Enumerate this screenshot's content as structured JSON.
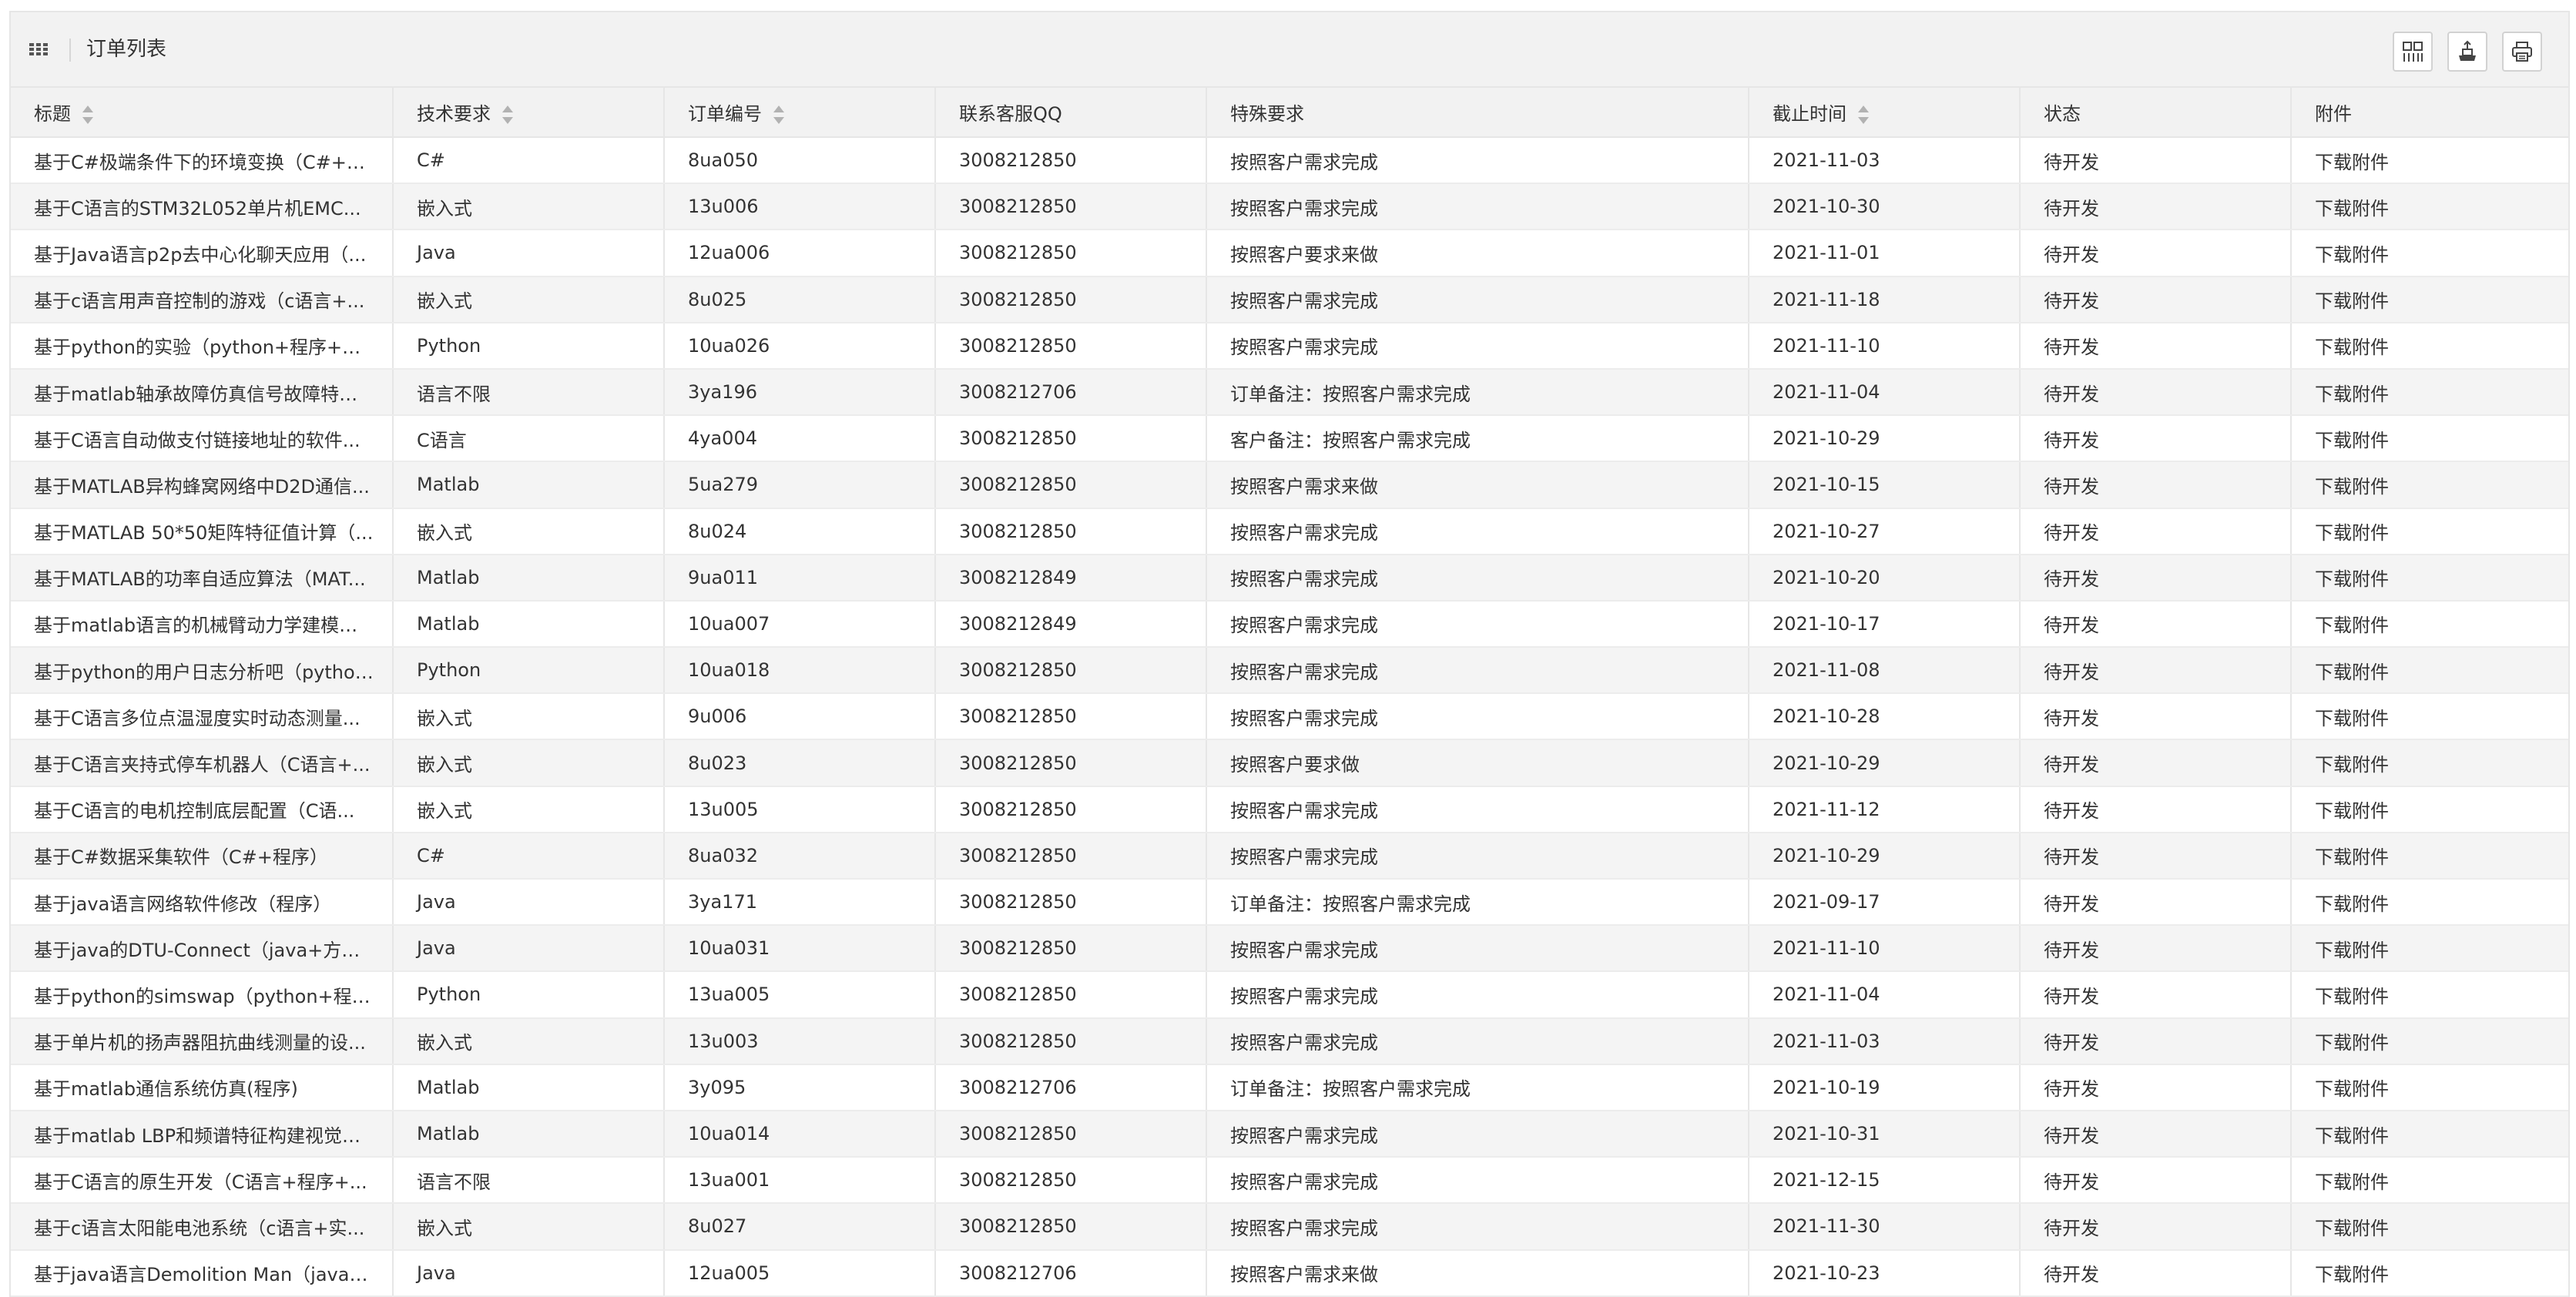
{
  "panel": {
    "title": "订单列表",
    "icons": {
      "menu": "grid-menu-icon",
      "columns": "columns-filter-icon",
      "export": "export-icon",
      "print": "print-icon"
    }
  },
  "table": {
    "columns": [
      "标题",
      "技术要求",
      "订单编号",
      "联系客服QQ",
      "特殊要求",
      "截止时间",
      "状态",
      "附件"
    ],
    "sortable_columns": [
      "标题",
      "技术要求",
      "订单编号",
      "截止时间"
    ],
    "rows": [
      [
        "基于C#极端条件下的环境变换（C#+程...",
        "C#",
        "8ua050",
        "3008212850",
        "按照客户需求完成",
        "2021-11-03",
        "待开发",
        "下载附件"
      ],
      [
        "基于C语言的STM32L052单片机EMC...",
        "嵌入式",
        "13u006",
        "3008212850",
        "按照客户需求完成",
        "2021-10-30",
        "待开发",
        "下载附件"
      ],
      [
        "基于Java语言p2p去中心化聊天应用（...",
        "Java",
        "12ua006",
        "3008212850",
        "按照客户要求来做",
        "2021-11-01",
        "待开发",
        "下载附件"
      ],
      [
        "基于c语言用声音控制的游戏（c语言+...",
        "嵌入式",
        "8u025",
        "3008212850",
        "按照客户需求完成",
        "2021-11-18",
        "待开发",
        "下载附件"
      ],
      [
        "基于python的实验（python+程序+方...",
        "Python",
        "10ua026",
        "3008212850",
        "按照客户需求完成",
        "2021-11-10",
        "待开发",
        "下载附件"
      ],
      [
        "基于matlab轴承故障仿真信号故障特征...",
        "语言不限",
        "3ya196",
        "3008212706",
        "订单备注：按照客户需求完成",
        "2021-11-04",
        "待开发",
        "下载附件"
      ],
      [
        "基于C语言自动做支付链接地址的软件...",
        "C语言",
        "4ya004",
        "3008212850",
        "客户备注：按照客户需求完成",
        "2021-10-29",
        "待开发",
        "下载附件"
      ],
      [
        "基于MATLAB异构蜂窝网络中D2D通信...",
        "Matlab",
        "5ua279",
        "3008212850",
        "按照客户需求来做",
        "2021-10-15",
        "待开发",
        "下载附件"
      ],
      [
        "基于MATLAB 50*50矩阵特征值计算（...",
        "嵌入式",
        "8u024",
        "3008212850",
        "按照客户需求完成",
        "2021-10-27",
        "待开发",
        "下载附件"
      ],
      [
        "基于MATLAB的功率自适应算法（MAT...",
        "Matlab",
        "9ua011",
        "3008212849",
        "按照客户需求完成",
        "2021-10-20",
        "待开发",
        "下载附件"
      ],
      [
        "基于matlab语言的机械臂动力学建模（...",
        "Matlab",
        "10ua007",
        "3008212849",
        "按照客户需求完成",
        "2021-10-17",
        "待开发",
        "下载附件"
      ],
      [
        "基于python的用户日志分析吧（python...",
        "Python",
        "10ua018",
        "3008212850",
        "按照客户需求完成",
        "2021-11-08",
        "待开发",
        "下载附件"
      ],
      [
        "基于C语言多位点温湿度实时动态测量...",
        "嵌入式",
        "9u006",
        "3008212850",
        "按照客户需求完成",
        "2021-10-28",
        "待开发",
        "下载附件"
      ],
      [
        "基于C语言夹持式停车机器人（C语言+...",
        "嵌入式",
        "8u023",
        "3008212850",
        "按照客户要求做",
        "2021-10-29",
        "待开发",
        "下载附件"
      ],
      [
        "基于C语言的电机控制底层配置（C语...",
        "嵌入式",
        "13u005",
        "3008212850",
        "按照客户需求完成",
        "2021-11-12",
        "待开发",
        "下载附件"
      ],
      [
        "基于C#数据采集软件（C#+程序）",
        "C#",
        "8ua032",
        "3008212850",
        "按照客户需求完成",
        "2021-10-29",
        "待开发",
        "下载附件"
      ],
      [
        "基于java语言网络软件修改（程序）",
        "Java",
        "3ya171",
        "3008212850",
        "订单备注：按照客户需求完成",
        "2021-09-17",
        "待开发",
        "下载附件"
      ],
      [
        "基于java的DTU-Connect（java+方案+...",
        "Java",
        "10ua031",
        "3008212850",
        "按照客户需求完成",
        "2021-11-10",
        "待开发",
        "下载附件"
      ],
      [
        "基于python的simswap（python+程序...",
        "Python",
        "13ua005",
        "3008212850",
        "按照客户需求完成",
        "2021-11-04",
        "待开发",
        "下载附件"
      ],
      [
        "基于单片机的扬声器阻抗曲线测量的设...",
        "嵌入式",
        "13u003",
        "3008212850",
        "按照客户需求完成",
        "2021-11-03",
        "待开发",
        "下载附件"
      ],
      [
        "基于matlab通信系统仿真(程序)",
        "Matlab",
        "3y095",
        "3008212706",
        "订单备注：按照客户需求完成",
        "2021-10-19",
        "待开发",
        "下载附件"
      ],
      [
        "基于matlab LBP和频谱特征构建视觉融...",
        "Matlab",
        "10ua014",
        "3008212850",
        "按照客户需求完成",
        "2021-10-31",
        "待开发",
        "下载附件"
      ],
      [
        "基于C语言的原生开发（C语言+程序+...",
        "语言不限",
        "13ua001",
        "3008212850",
        "按照客户需求完成",
        "2021-12-15",
        "待开发",
        "下载附件"
      ],
      [
        "基于c语言太阳能电池系统（c语言+实...",
        "嵌入式",
        "8u027",
        "3008212850",
        "按照客户需求完成",
        "2021-11-30",
        "待开发",
        "下载附件"
      ],
      [
        "基于java语言Demolition Man（java+方...",
        "Java",
        "12ua005",
        "3008212706",
        "按照客户需求来做",
        "2021-10-23",
        "待开发",
        "下载附件"
      ]
    ]
  }
}
